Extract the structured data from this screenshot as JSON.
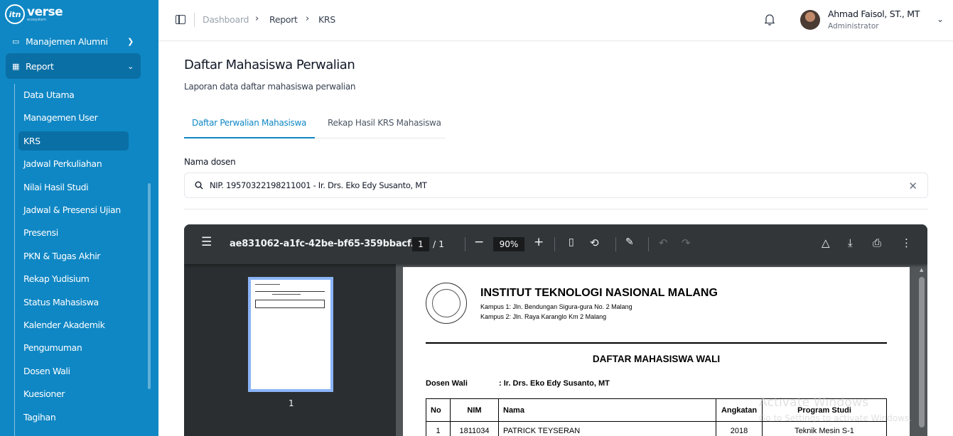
{
  "brand": {
    "logo_mark": "itn",
    "logo_text": "verse",
    "tagline": "ecosystem"
  },
  "sidebar": {
    "alumni_label": "Manajemen Alumni",
    "report_label": "Report",
    "sub_items": [
      {
        "label": "Data Utama"
      },
      {
        "label": "Managemen User"
      },
      {
        "label": "KRS"
      },
      {
        "label": "Jadwal Perkuliahan"
      },
      {
        "label": "Nilai Hasil Studi"
      },
      {
        "label": "Jadwal & Presensi Ujian"
      },
      {
        "label": "Presensi"
      },
      {
        "label": "PKN & Tugas Akhir"
      },
      {
        "label": "Rekap Yudisium"
      },
      {
        "label": "Status Mahasiswa"
      },
      {
        "label": "Kalender Akademik"
      },
      {
        "label": "Pengumuman"
      },
      {
        "label": "Dosen Wali"
      },
      {
        "label": "Kuesioner"
      },
      {
        "label": "Tagihan"
      }
    ],
    "active_item": "KRS",
    "colors": {
      "bg": "#0f87c4",
      "active": "#0a6fa5"
    }
  },
  "topbar": {
    "breadcrumb": [
      "Dashboard",
      "Report",
      "KRS"
    ],
    "user_name": "Ahmad Faisol, ST., MT",
    "user_role": "Administrator",
    "icons": [
      "sidebar-toggle-icon",
      "bell-icon",
      "chevron-down-icon"
    ]
  },
  "main": {
    "title": "Daftar Mahasiswa Perwalian",
    "subtitle": "Laporan data daftar mahasiswa perwalian",
    "tabs": [
      {
        "label": "Daftar Perwalian Mahasiswa",
        "active": true
      },
      {
        "label": "Rekap Hasil KRS Mahasiswa",
        "active": false
      }
    ],
    "field_label": "Nama dosen",
    "field_value": "NIP. 19570322198211001 - Ir. Drs. Eko Edy Susanto, MT"
  },
  "pdf": {
    "filename": "ae831062-a1fc-42be-bf65-359bbacf...",
    "page_current": "1",
    "page_total": "/  1",
    "zoom": "90%",
    "thumb_page": "1",
    "doc": {
      "institution": "INSTITUT TEKNOLOGI NASIONAL MALANG",
      "campus1": "Kampus 1: Jln. Bendungan Sigura-gura No. 2 Malang",
      "campus2": "Kampus 2: Jln. Raya Karanglo Km 2 Malang",
      "heading": "DAFTAR MAHASISWA WALI",
      "dosen_label": "Dosen Wali",
      "dosen_value": ": Ir. Drs. Eko Edy Susanto, MT",
      "columns": [
        "No",
        "NIM",
        "Nama",
        "Angkatan",
        "Program Studi"
      ],
      "rows": [
        [
          "1",
          "1811034",
          "PATRICK TEYSERAN",
          "2018",
          "Teknik Mesin S-1"
        ]
      ]
    }
  },
  "watermark": {
    "line1": "Activate Windows",
    "line2": "Go to Settings to activate Windows."
  }
}
